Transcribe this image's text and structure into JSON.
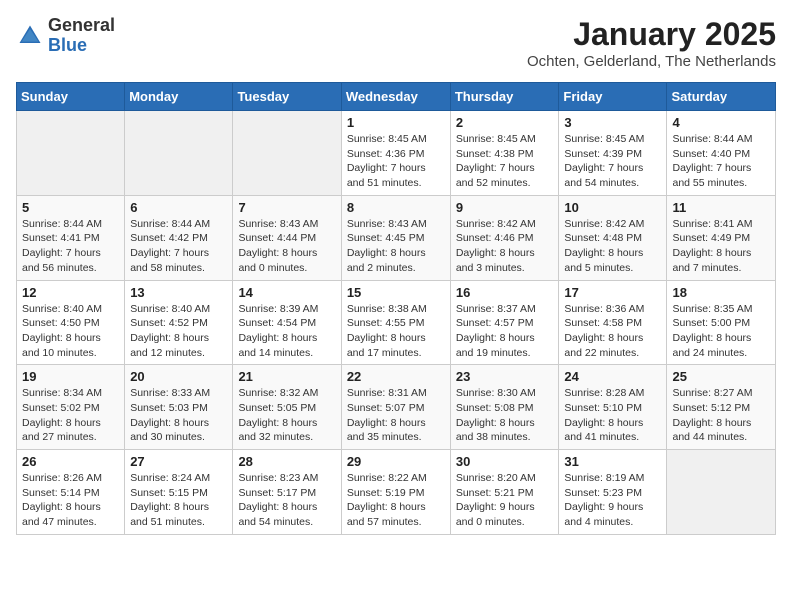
{
  "header": {
    "logo_general": "General",
    "logo_blue": "Blue",
    "title": "January 2025",
    "location": "Ochten, Gelderland, The Netherlands"
  },
  "days_of_week": [
    "Sunday",
    "Monday",
    "Tuesday",
    "Wednesday",
    "Thursday",
    "Friday",
    "Saturday"
  ],
  "weeks": [
    [
      {
        "day": "",
        "info": ""
      },
      {
        "day": "",
        "info": ""
      },
      {
        "day": "",
        "info": ""
      },
      {
        "day": "1",
        "info": "Sunrise: 8:45 AM\nSunset: 4:36 PM\nDaylight: 7 hours\nand 51 minutes."
      },
      {
        "day": "2",
        "info": "Sunrise: 8:45 AM\nSunset: 4:38 PM\nDaylight: 7 hours\nand 52 minutes."
      },
      {
        "day": "3",
        "info": "Sunrise: 8:45 AM\nSunset: 4:39 PM\nDaylight: 7 hours\nand 54 minutes."
      },
      {
        "day": "4",
        "info": "Sunrise: 8:44 AM\nSunset: 4:40 PM\nDaylight: 7 hours\nand 55 minutes."
      }
    ],
    [
      {
        "day": "5",
        "info": "Sunrise: 8:44 AM\nSunset: 4:41 PM\nDaylight: 7 hours\nand 56 minutes."
      },
      {
        "day": "6",
        "info": "Sunrise: 8:44 AM\nSunset: 4:42 PM\nDaylight: 7 hours\nand 58 minutes."
      },
      {
        "day": "7",
        "info": "Sunrise: 8:43 AM\nSunset: 4:44 PM\nDaylight: 8 hours\nand 0 minutes."
      },
      {
        "day": "8",
        "info": "Sunrise: 8:43 AM\nSunset: 4:45 PM\nDaylight: 8 hours\nand 2 minutes."
      },
      {
        "day": "9",
        "info": "Sunrise: 8:42 AM\nSunset: 4:46 PM\nDaylight: 8 hours\nand 3 minutes."
      },
      {
        "day": "10",
        "info": "Sunrise: 8:42 AM\nSunset: 4:48 PM\nDaylight: 8 hours\nand 5 minutes."
      },
      {
        "day": "11",
        "info": "Sunrise: 8:41 AM\nSunset: 4:49 PM\nDaylight: 8 hours\nand 7 minutes."
      }
    ],
    [
      {
        "day": "12",
        "info": "Sunrise: 8:40 AM\nSunset: 4:50 PM\nDaylight: 8 hours\nand 10 minutes."
      },
      {
        "day": "13",
        "info": "Sunrise: 8:40 AM\nSunset: 4:52 PM\nDaylight: 8 hours\nand 12 minutes."
      },
      {
        "day": "14",
        "info": "Sunrise: 8:39 AM\nSunset: 4:54 PM\nDaylight: 8 hours\nand 14 minutes."
      },
      {
        "day": "15",
        "info": "Sunrise: 8:38 AM\nSunset: 4:55 PM\nDaylight: 8 hours\nand 17 minutes."
      },
      {
        "day": "16",
        "info": "Sunrise: 8:37 AM\nSunset: 4:57 PM\nDaylight: 8 hours\nand 19 minutes."
      },
      {
        "day": "17",
        "info": "Sunrise: 8:36 AM\nSunset: 4:58 PM\nDaylight: 8 hours\nand 22 minutes."
      },
      {
        "day": "18",
        "info": "Sunrise: 8:35 AM\nSunset: 5:00 PM\nDaylight: 8 hours\nand 24 minutes."
      }
    ],
    [
      {
        "day": "19",
        "info": "Sunrise: 8:34 AM\nSunset: 5:02 PM\nDaylight: 8 hours\nand 27 minutes."
      },
      {
        "day": "20",
        "info": "Sunrise: 8:33 AM\nSunset: 5:03 PM\nDaylight: 8 hours\nand 30 minutes."
      },
      {
        "day": "21",
        "info": "Sunrise: 8:32 AM\nSunset: 5:05 PM\nDaylight: 8 hours\nand 32 minutes."
      },
      {
        "day": "22",
        "info": "Sunrise: 8:31 AM\nSunset: 5:07 PM\nDaylight: 8 hours\nand 35 minutes."
      },
      {
        "day": "23",
        "info": "Sunrise: 8:30 AM\nSunset: 5:08 PM\nDaylight: 8 hours\nand 38 minutes."
      },
      {
        "day": "24",
        "info": "Sunrise: 8:28 AM\nSunset: 5:10 PM\nDaylight: 8 hours\nand 41 minutes."
      },
      {
        "day": "25",
        "info": "Sunrise: 8:27 AM\nSunset: 5:12 PM\nDaylight: 8 hours\nand 44 minutes."
      }
    ],
    [
      {
        "day": "26",
        "info": "Sunrise: 8:26 AM\nSunset: 5:14 PM\nDaylight: 8 hours\nand 47 minutes."
      },
      {
        "day": "27",
        "info": "Sunrise: 8:24 AM\nSunset: 5:15 PM\nDaylight: 8 hours\nand 51 minutes."
      },
      {
        "day": "28",
        "info": "Sunrise: 8:23 AM\nSunset: 5:17 PM\nDaylight: 8 hours\nand 54 minutes."
      },
      {
        "day": "29",
        "info": "Sunrise: 8:22 AM\nSunset: 5:19 PM\nDaylight: 8 hours\nand 57 minutes."
      },
      {
        "day": "30",
        "info": "Sunrise: 8:20 AM\nSunset: 5:21 PM\nDaylight: 9 hours\nand 0 minutes."
      },
      {
        "day": "31",
        "info": "Sunrise: 8:19 AM\nSunset: 5:23 PM\nDaylight: 9 hours\nand 4 minutes."
      },
      {
        "day": "",
        "info": ""
      }
    ]
  ]
}
